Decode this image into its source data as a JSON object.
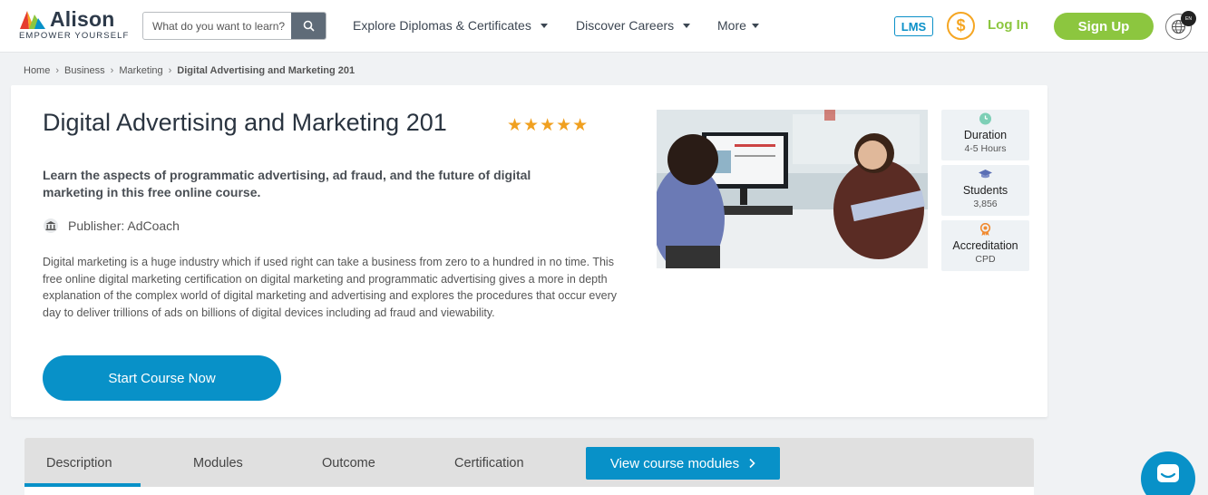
{
  "header": {
    "logo_text": "Alison",
    "logo_tagline": "EMPOWER YOURSELF",
    "search_placeholder": "What do you want to learn?",
    "nav": [
      {
        "label": "Explore Diplomas & Certificates",
        "has_dropdown": true
      },
      {
        "label": "Discover Careers",
        "has_dropdown": true
      },
      {
        "label": "More",
        "has_dropdown": true
      }
    ],
    "lms_label": "LMS",
    "coin_symbol": "$",
    "login_label": "Log In",
    "signup_label": "Sign Up",
    "language_badge": "EN"
  },
  "breadcrumb": [
    "Home",
    "Business",
    "Marketing",
    "Digital Advertising and Marketing 201"
  ],
  "course": {
    "title": "Digital Advertising and Marketing 201",
    "stars": "★★★★★",
    "rating": 5,
    "subtitle": "Learn the aspects of programmatic advertising, ad fraud, and the future of digital marketing in this free online course.",
    "publisher": "Publisher: AdCoach",
    "description": "Digital marketing is a huge industry which if used right can take a business from zero to a hundred in no time. This free online digital marketing certification on digital marketing and programmatic advertising gives a more in depth explanation of the complex world of digital marketing and advertising and explores the procedures that occur every day to deliver trillions of ads on billions of digital devices including ad fraud and viewability.",
    "start_button": "Start Course Now"
  },
  "stats": [
    {
      "label": "Duration",
      "value": "4-5 Hours",
      "icon": "clock-icon"
    },
    {
      "label": "Students",
      "value": "3,856",
      "icon": "graduation-cap-icon"
    },
    {
      "label": "Accreditation",
      "value": "CPD",
      "icon": "award-icon"
    }
  ],
  "tabs": [
    {
      "label": "Description",
      "active": true
    },
    {
      "label": "Modules",
      "active": false
    },
    {
      "label": "Outcome",
      "active": false
    },
    {
      "label": "Certification",
      "active": false
    }
  ],
  "view_modules_label": "View course modules",
  "colors": {
    "primary": "#0891c8",
    "green": "#8cc63f",
    "coin": "#f5a623",
    "star": "#f0a020"
  }
}
